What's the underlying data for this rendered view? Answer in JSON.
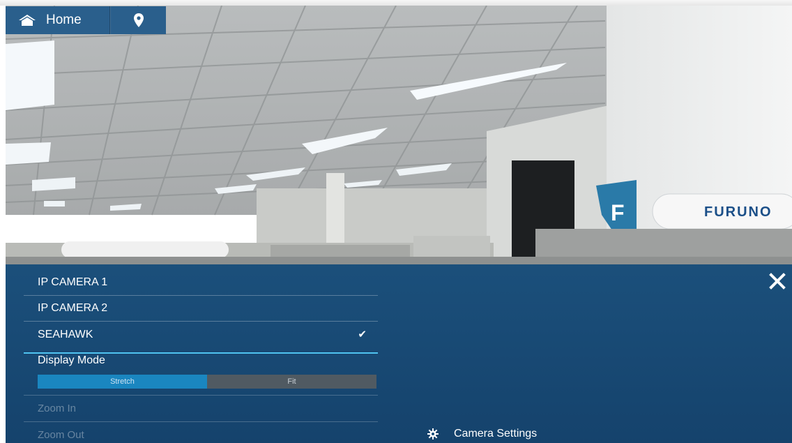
{
  "topbar": {
    "home_label": "Home",
    "home_icon": "home-icon",
    "location_icon": "location-pin-icon"
  },
  "camera_feed": {
    "watermark_text": "FURUNO"
  },
  "camera_panel": {
    "cameras": [
      {
        "label": "IP CAMERA 1",
        "selected": false
      },
      {
        "label": "IP CAMERA 2",
        "selected": false
      },
      {
        "label": "SEAHAWK",
        "selected": true
      }
    ],
    "selected_check": "✔",
    "display_mode": {
      "label": "Display Mode",
      "options": [
        "Stretch",
        "Fit"
      ],
      "selected": "Stretch"
    },
    "zoom_in_label": "Zoom In",
    "zoom_out_label": "Zoom Out",
    "camera_settings_label": "Camera Settings",
    "close_icon": "close-icon"
  },
  "colors": {
    "panel_bg": "#154c7a",
    "accent": "#4fc3f0",
    "toggle_active": "#1a86c0",
    "toggle_inactive": "#505a62",
    "topbar_button": "#2a5f8c"
  }
}
